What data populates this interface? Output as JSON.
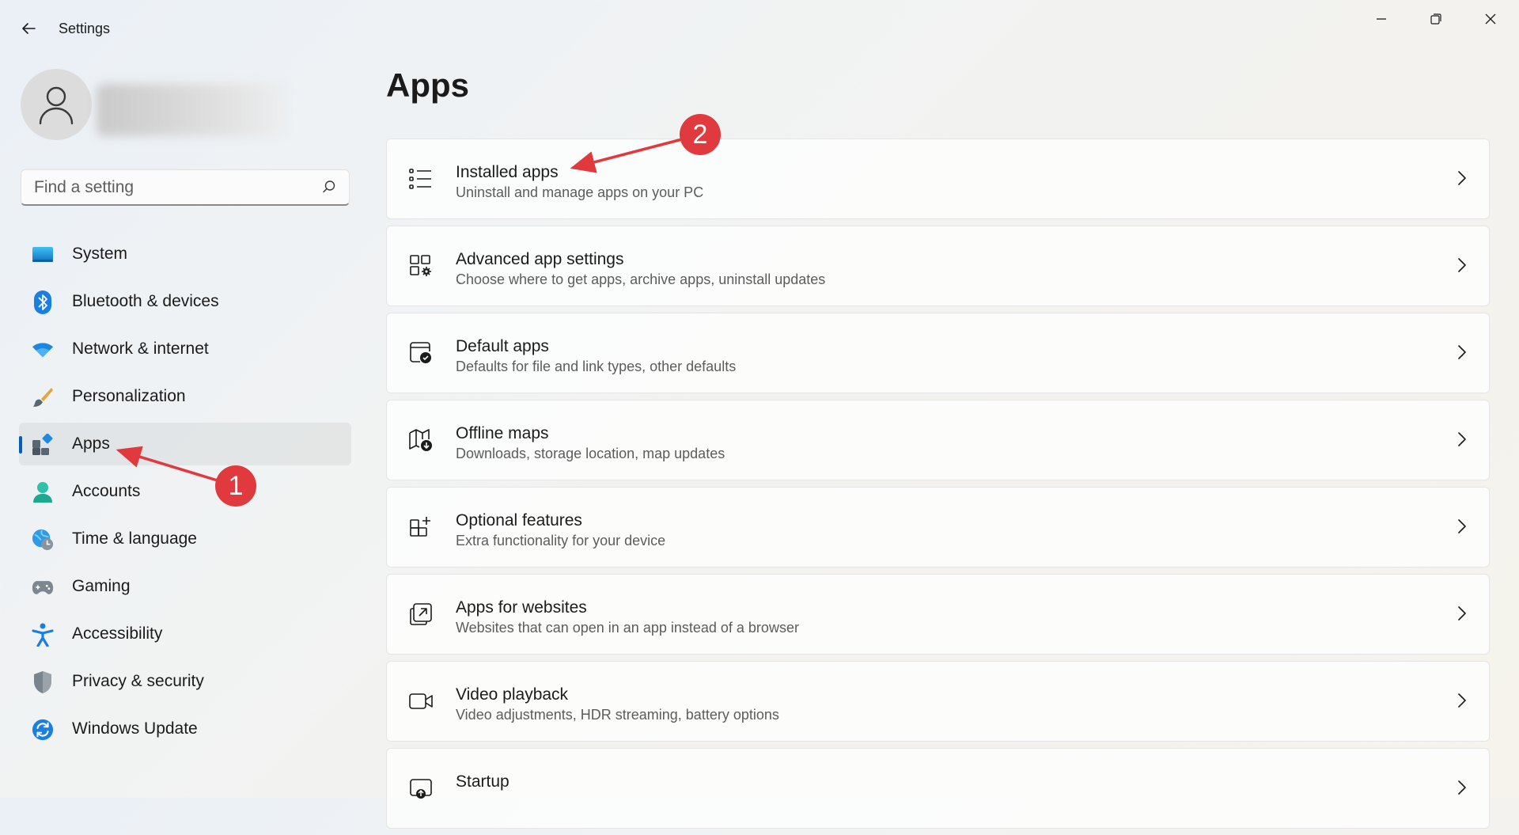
{
  "window": {
    "title": "Settings",
    "controls": {
      "minimize": "minimize-icon",
      "maximize": "restore-icon",
      "close": "close-icon"
    }
  },
  "search": {
    "placeholder": "Find a setting"
  },
  "sidebar": {
    "items": [
      {
        "label": "System",
        "icon": "system-icon"
      },
      {
        "label": "Bluetooth & devices",
        "icon": "bluetooth-icon"
      },
      {
        "label": "Network & internet",
        "icon": "wifi-icon"
      },
      {
        "label": "Personalization",
        "icon": "brush-icon"
      },
      {
        "label": "Apps",
        "icon": "apps-icon",
        "active": true
      },
      {
        "label": "Accounts",
        "icon": "accounts-icon"
      },
      {
        "label": "Time & language",
        "icon": "globe-clock-icon"
      },
      {
        "label": "Gaming",
        "icon": "gamepad-icon"
      },
      {
        "label": "Accessibility",
        "icon": "accessibility-icon"
      },
      {
        "label": "Privacy & security",
        "icon": "shield-icon"
      },
      {
        "label": "Windows Update",
        "icon": "update-icon"
      }
    ]
  },
  "main": {
    "title": "Apps",
    "cards": [
      {
        "title": "Installed apps",
        "subtitle": "Uninstall and manage apps on your PC",
        "icon": "list-icon"
      },
      {
        "title": "Advanced app settings",
        "subtitle": "Choose where to get apps, archive apps, uninstall updates",
        "icon": "app-settings-icon"
      },
      {
        "title": "Default apps",
        "subtitle": "Defaults for file and link types, other defaults",
        "icon": "default-apps-icon"
      },
      {
        "title": "Offline maps",
        "subtitle": "Downloads, storage location, map updates",
        "icon": "map-icon"
      },
      {
        "title": "Optional features",
        "subtitle": "Extra functionality for your device",
        "icon": "optional-features-icon"
      },
      {
        "title": "Apps for websites",
        "subtitle": "Websites that can open in an app instead of a browser",
        "icon": "open-in-app-icon"
      },
      {
        "title": "Video playback",
        "subtitle": "Video adjustments, HDR streaming, battery options",
        "icon": "video-icon"
      },
      {
        "title": "Startup",
        "subtitle": "",
        "icon": "startup-icon"
      }
    ]
  },
  "annotations": {
    "badge1": "1",
    "badge2": "2",
    "color": "#e0393e"
  },
  "colors": {
    "accent": "#005fb8"
  }
}
